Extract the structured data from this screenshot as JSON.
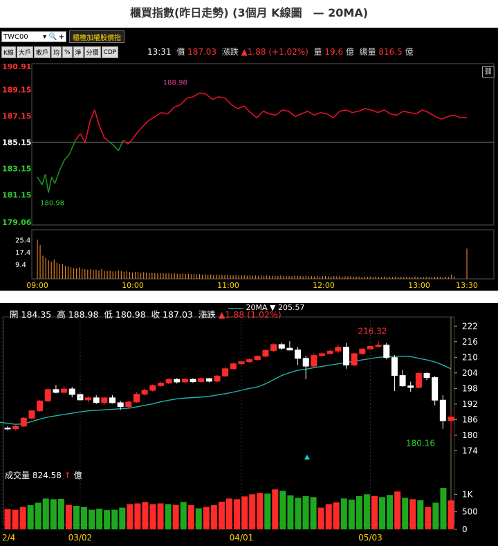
{
  "title": "櫃買指數(昨日走勢) (3個月 K線圖　— 20MA)",
  "intraday": {
    "symbol": "TWC00",
    "yellow_button": "櫃檯加權股價指",
    "toolbar": [
      "K線",
      "大戶",
      "散戶",
      "均",
      "%",
      "淨",
      "分價",
      "CDP"
    ],
    "time": "13:31",
    "price_label": "價",
    "price": "187.03",
    "change_label": "漲跌",
    "change": "▲1.88 (+1.02%)",
    "vol_label": "量",
    "volume": "19.6",
    "vol_unit": "億",
    "total_label": "總量",
    "total": "816.5",
    "total_unit": "億"
  },
  "daily": {
    "open_label": "開",
    "open": "184.35",
    "high_label": "高",
    "high": "188.98",
    "low_label": "低",
    "low": "180.98",
    "close_label": "收",
    "close": "187.03",
    "change_label": "漲跌",
    "change": "▲1.88 (1.02%)",
    "ma_label": "20MA",
    "ma_value": "205.57",
    "vol_label": "成交量",
    "vol_value": "824.58",
    "vol_unit": "億"
  },
  "colors": {
    "up": "#ff2a2a",
    "down": "#1fa81f",
    "ma": "#20b2aa",
    "price_up": "#e8102a",
    "price_down": "#1c8f1c"
  },
  "chart_data": [
    {
      "type": "line",
      "title": "",
      "ylim": [
        179.06,
        190.91
      ],
      "y_ticks": [
        "190.91",
        "189.15",
        "187.15",
        "185.15",
        "183.15",
        "181.15",
        "179.06"
      ],
      "y_tick_values": [
        190.91,
        189.15,
        187.15,
        185.15,
        183.15,
        181.15,
        179.06
      ],
      "x_ticks": [
        "09:00",
        "10:00",
        "11:00",
        "12:00",
        "13:00",
        "13:30"
      ],
      "x_tick_minutes": [
        0,
        60,
        120,
        180,
        240,
        270
      ],
      "reference": 185.15,
      "annotations": [
        {
          "text": "188.98",
          "minute": 86,
          "value": 188.98
        },
        {
          "text": "180.98",
          "minute": 7,
          "value": 180.98
        }
      ],
      "series": [
        {
          "minutes": [
            0,
            3,
            5,
            7,
            9,
            11,
            14,
            17,
            20,
            24,
            27,
            30,
            33,
            36,
            39,
            42,
            45,
            48,
            51,
            54,
            57,
            60,
            63,
            66,
            70,
            74,
            78,
            82,
            86,
            90,
            94,
            98,
            102,
            106,
            110,
            114,
            118,
            122,
            126,
            130,
            134,
            138,
            142,
            146,
            150,
            154,
            158,
            162,
            166,
            170,
            174,
            178,
            182,
            186,
            190,
            194,
            198,
            202,
            206,
            210,
            214,
            218,
            222,
            226,
            230,
            234,
            238,
            242,
            246,
            250,
            254,
            258,
            262,
            266,
            270
          ],
          "values": [
            182.5,
            181.9,
            182.7,
            181.3,
            182.5,
            182.0,
            183.0,
            183.8,
            184.2,
            185.3,
            185.8,
            185.1,
            186.7,
            187.6,
            186.4,
            185.5,
            185.2,
            184.9,
            184.5,
            185.3,
            185.0,
            185.4,
            185.9,
            186.3,
            186.8,
            187.1,
            187.4,
            187.3,
            187.8,
            188.0,
            188.5,
            188.6,
            188.9,
            188.8,
            188.4,
            188.6,
            188.5,
            188.0,
            187.7,
            187.9,
            187.4,
            187.0,
            187.5,
            187.3,
            187.2,
            187.6,
            187.5,
            187.1,
            187.3,
            187.5,
            187.2,
            187.4,
            187.3,
            187.0,
            187.5,
            187.6,
            187.4,
            187.5,
            187.7,
            187.6,
            187.4,
            187.6,
            187.3,
            187.2,
            187.5,
            187.4,
            187.3,
            187.6,
            187.4,
            187.1,
            186.9,
            187.1,
            187.2,
            187.0,
            187.03
          ]
        }
      ]
    },
    {
      "type": "bar",
      "title": "",
      "ylim": [
        0,
        30
      ],
      "y_ticks": [
        "25.4",
        "17.4",
        "9.4"
      ],
      "y_tick_values": [
        25.4,
        17.4,
        9.4
      ],
      "bars": [
        25.4,
        22.0,
        15.0,
        13.5,
        12.0,
        11.2,
        12.5,
        10.5,
        9.8,
        9.5,
        8.5,
        8.0,
        7.4,
        7.0,
        6.8,
        7.5,
        6.5,
        6.3,
        6.0,
        6.2,
        5.8,
        6.0,
        5.5,
        6.5,
        5.2,
        5.0,
        5.3,
        4.8,
        4.9,
        5.5,
        5.1,
        4.6,
        4.8,
        4.5,
        4.2,
        4.6,
        4.4,
        4.0,
        4.3,
        4.1,
        3.9,
        4.0,
        3.8,
        3.7,
        3.9,
        3.6,
        3.5,
        3.8,
        3.4,
        3.6,
        3.3,
        3.2,
        3.5,
        3.1,
        3.3,
        3.0,
        3.2,
        2.9,
        3.1,
        2.8,
        3.0,
        2.7,
        2.9,
        2.6,
        2.8,
        2.5,
        2.7,
        2.4,
        2.6,
        2.5,
        2.3,
        2.6,
        2.2,
        2.4,
        2.3,
        2.1,
        2.5,
        2.0,
        2.2,
        2.1,
        2.4,
        2.0,
        2.3,
        1.9,
        2.1,
        2.0,
        1.8,
        2.2,
        1.9,
        2.0,
        1.8,
        1.7,
        2.1,
        1.8,
        1.9,
        1.6,
        2.0,
        1.7,
        1.8,
        1.6,
        1.9,
        1.5,
        1.7,
        1.8,
        1.6,
        1.5,
        1.8,
        1.6,
        1.7,
        1.4,
        1.6,
        1.5,
        1.7,
        1.4,
        1.6,
        1.5,
        1.3,
        1.6,
        1.4,
        1.5,
        1.3,
        1.6,
        1.4,
        1.2,
        1.5,
        1.3,
        1.4,
        1.2,
        1.5,
        1.3,
        1.4,
        1.2,
        1.3,
        1.4,
        1.2,
        1.5,
        1.3,
        1.3,
        1.2,
        1.4,
        1.3,
        1.2,
        1.5,
        1.3,
        1.4,
        1.2,
        1.5,
        1.3,
        2.8,
        1.6,
        19.6
      ]
    },
    {
      "type": "candlestick",
      "title": "",
      "ylim": [
        168,
        225
      ],
      "y_ticks": [
        "222",
        "216",
        "210",
        "204",
        "198",
        "192",
        "186",
        "180",
        "174"
      ],
      "y_tick_values": [
        222,
        216,
        210,
        204,
        198,
        192,
        186,
        180,
        174
      ],
      "x_ticks": [
        "2/4",
        "03/02",
        "04/01",
        "05/03"
      ],
      "x_tick_index": [
        0,
        9,
        29,
        45
      ],
      "annotations": [
        {
          "text": "216.32",
          "index": 45,
          "value": 216.32
        },
        {
          "text": "180.16",
          "index": 52,
          "value": 180.16
        }
      ],
      "ohlc": [
        [
          182.8,
          183.4,
          182.0,
          182.6
        ],
        [
          182.5,
          183.8,
          181.9,
          183.5
        ],
        [
          183.5,
          187.0,
          183.1,
          186.6
        ],
        [
          186.6,
          189.8,
          186.2,
          189.4
        ],
        [
          189.4,
          193.7,
          189.0,
          193.2
        ],
        [
          193.2,
          198.0,
          192.8,
          197.6
        ],
        [
          197.6,
          199.4,
          196.1,
          196.5
        ],
        [
          196.5,
          199.0,
          195.8,
          197.8
        ],
        [
          197.8,
          198.6,
          194.6,
          195.7
        ],
        [
          195.7,
          196.4,
          193.0,
          193.6
        ],
        [
          193.6,
          195.0,
          192.7,
          194.4
        ],
        [
          194.4,
          195.4,
          192.0,
          192.6
        ],
        [
          192.6,
          194.9,
          191.8,
          194.4
        ],
        [
          194.4,
          195.4,
          192.2,
          192.5
        ],
        [
          192.5,
          193.2,
          189.8,
          191.0
        ],
        [
          191.0,
          193.3,
          190.2,
          192.8
        ],
        [
          192.8,
          196.5,
          192.5,
          195.8
        ],
        [
          195.8,
          198.0,
          195.3,
          197.3
        ],
        [
          197.3,
          199.6,
          196.8,
          199.1
        ],
        [
          199.1,
          200.6,
          198.6,
          200.1
        ],
        [
          200.1,
          201.9,
          199.7,
          201.5
        ],
        [
          201.5,
          202.0,
          199.9,
          200.5
        ],
        [
          200.5,
          202.1,
          200.0,
          201.5
        ],
        [
          201.5,
          202.0,
          200.1,
          200.6
        ],
        [
          200.6,
          202.3,
          200.2,
          201.8
        ],
        [
          201.8,
          202.0,
          200.3,
          200.8
        ],
        [
          200.8,
          203.2,
          200.4,
          202.8
        ],
        [
          202.8,
          206.1,
          202.4,
          205.6
        ],
        [
          205.6,
          208.0,
          205.2,
          207.5
        ],
        [
          207.5,
          208.8,
          207.0,
          208.3
        ],
        [
          208.3,
          209.6,
          207.8,
          209.1
        ],
        [
          209.1,
          210.8,
          208.7,
          210.4
        ],
        [
          210.4,
          213.2,
          210.0,
          212.6
        ],
        [
          212.6,
          215.4,
          212.2,
          214.9
        ],
        [
          214.9,
          215.6,
          212.8,
          213.5
        ],
        [
          213.5,
          216.2,
          212.6,
          212.8
        ],
        [
          212.8,
          214.0,
          207.0,
          209.6
        ],
        [
          209.6,
          210.6,
          201.5,
          206.6
        ],
        [
          206.6,
          211.6,
          206.0,
          210.7
        ],
        [
          210.7,
          212.0,
          209.9,
          211.4
        ],
        [
          211.4,
          213.0,
          211.0,
          212.4
        ],
        [
          212.4,
          215.0,
          211.6,
          213.9
        ],
        [
          213.9,
          215.5,
          205.6,
          207.0
        ],
        [
          207.0,
          211.8,
          206.5,
          211.4
        ],
        [
          211.4,
          213.6,
          211.0,
          213.2
        ],
        [
          213.2,
          214.6,
          212.8,
          214.2
        ],
        [
          214.2,
          216.32,
          213.6,
          214.7
        ],
        [
          214.7,
          215.5,
          209.2,
          209.9
        ],
        [
          209.9,
          210.8,
          197.0,
          203.0
        ],
        [
          203.0,
          205.1,
          198.6,
          199.0
        ],
        [
          199.0,
          200.6,
          196.7,
          198.4
        ],
        [
          198.4,
          204.3,
          198.0,
          203.8
        ],
        [
          203.8,
          204.2,
          201.3,
          202.2
        ],
        [
          202.2,
          202.8,
          191.5,
          193.5
        ],
        [
          193.5,
          195.4,
          182.4,
          185.6
        ],
        [
          185.6,
          188.98,
          180.16,
          187.03
        ]
      ],
      "ma20": [
        185.0,
        184.6,
        184.2,
        184.4,
        185.3,
        186.2,
        187.0,
        187.5,
        188.0,
        188.5,
        189.0,
        189.4,
        189.6,
        189.8,
        190.0,
        190.2,
        190.4,
        190.9,
        191.5,
        192.1,
        192.9,
        193.5,
        194.0,
        194.3,
        194.5,
        194.7,
        195.0,
        195.5,
        196.0,
        196.6,
        197.3,
        198.0,
        198.6,
        199.8,
        201.4,
        203.0,
        204.1,
        205.0,
        205.4,
        206.0,
        206.5,
        207.0,
        207.5,
        208.0,
        208.5,
        209.0,
        209.5,
        210.0,
        210.2,
        210.4,
        210.4,
        210.3,
        209.6,
        209.0,
        208.2,
        207.0,
        205.57
      ]
    },
    {
      "type": "bar",
      "title": "",
      "ylim": [
        0,
        1400
      ],
      "y_ticks": [
        "1K",
        "500",
        "0"
      ],
      "y_tick_values": [
        1000,
        500,
        0
      ],
      "bars": [
        580,
        560,
        640,
        690,
        760,
        880,
        860,
        870,
        700,
        670,
        640,
        560,
        590,
        550,
        560,
        620,
        720,
        740,
        780,
        720,
        740,
        720,
        700,
        780,
        690,
        600,
        640,
        690,
        790,
        880,
        860,
        940,
        1000,
        1040,
        1020,
        1140,
        1100,
        970,
        900,
        950,
        920,
        620,
        720,
        770,
        880,
        850,
        950,
        1000,
        950,
        920,
        980,
        1080,
        900,
        860,
        830,
        640,
        760,
        1180,
        824.58
      ],
      "bar_up": [
        true,
        true,
        true,
        false,
        false,
        false,
        false,
        false,
        true,
        false,
        false,
        false,
        false,
        false,
        false,
        false,
        true,
        true,
        true,
        true,
        true,
        false,
        true,
        false,
        true,
        false,
        true,
        true,
        true,
        true,
        true,
        true,
        true,
        true,
        false,
        true,
        false,
        false,
        false,
        false,
        false,
        true,
        true,
        true,
        false,
        false,
        false,
        false,
        true,
        false,
        false,
        true,
        false,
        true,
        false,
        true,
        false,
        false,
        true
      ]
    }
  ]
}
